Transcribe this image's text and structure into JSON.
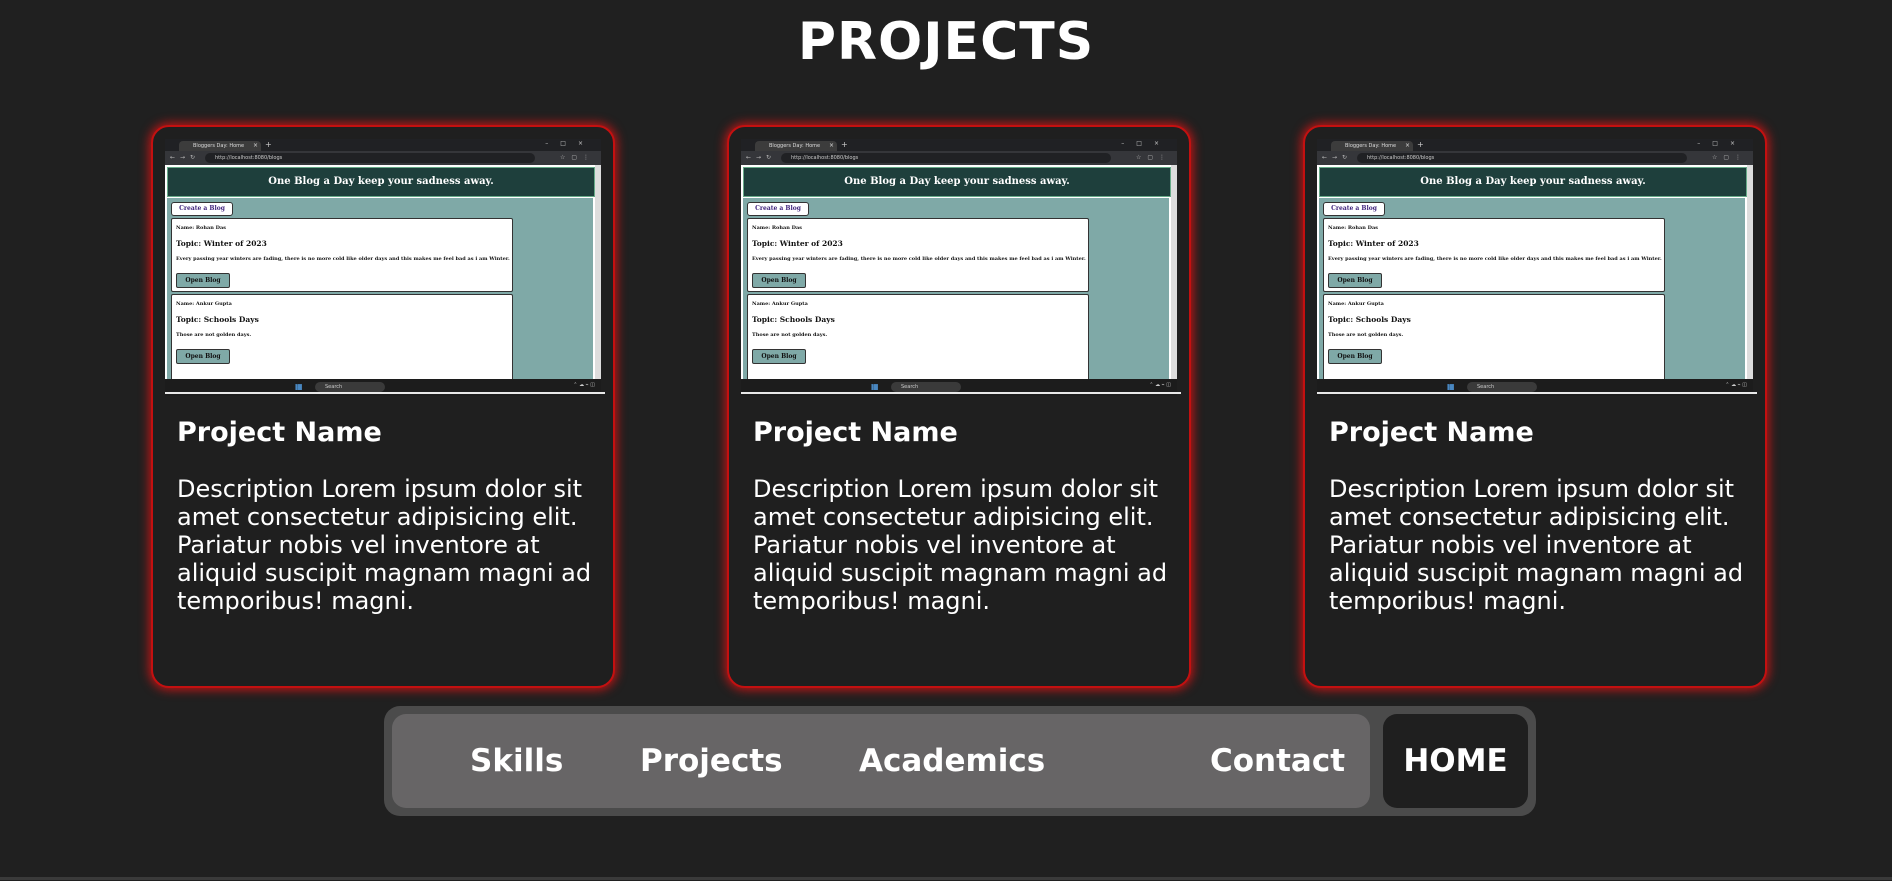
{
  "page": {
    "title": "PROJECTS"
  },
  "cards": [
    {
      "title": "Project Name",
      "description": "Description Lorem ipsum dolor sit amet consectetur adipisicing elit. Pariatur nobis vel inventore at aliquid suscipit magnam magni ad temporibus! magni."
    },
    {
      "title": "Project Name",
      "description": "Description Lorem ipsum dolor sit amet consectetur adipisicing elit. Pariatur nobis vel inventore at aliquid suscipit magnam magni ad temporibus! magni."
    },
    {
      "title": "Project Name",
      "description": "Description Lorem ipsum dolor sit amet consectetur adipisicing elit. Pariatur nobis vel inventore at aliquid suscipit magnam magni ad temporibus! magni."
    }
  ],
  "screenshot": {
    "tab_label": "Bloggers Day: Home",
    "url": "http://localhost:8080/blogs",
    "header": "One Blog a Day keep your sadness away.",
    "create_button": "Create a Blog",
    "posts": [
      {
        "author": "Name: Rohan Das",
        "topic": "Topic: Winter of 2023",
        "text": "Every passing year winters are fading, there is no more cold like older days and this makes me feel bad as i am Winter.",
        "button": "Open Blog"
      },
      {
        "author": "Name: Ankur Gupta",
        "topic": "Topic: Schools Days",
        "text": "Those are not golden days.",
        "button": "Open Blog"
      }
    ],
    "taskbar_search": "Search"
  },
  "nav": {
    "links": [
      "Skills",
      "Projects",
      "Academics",
      "Contact"
    ],
    "home": "HOME"
  },
  "colors": {
    "background": "#202020",
    "card_border": "#c41010",
    "nav_bg": "#4b4b4b",
    "nav_links_bg": "#676566",
    "blog_header": "#1e3f3c",
    "blog_body": "#7fa9a7"
  }
}
